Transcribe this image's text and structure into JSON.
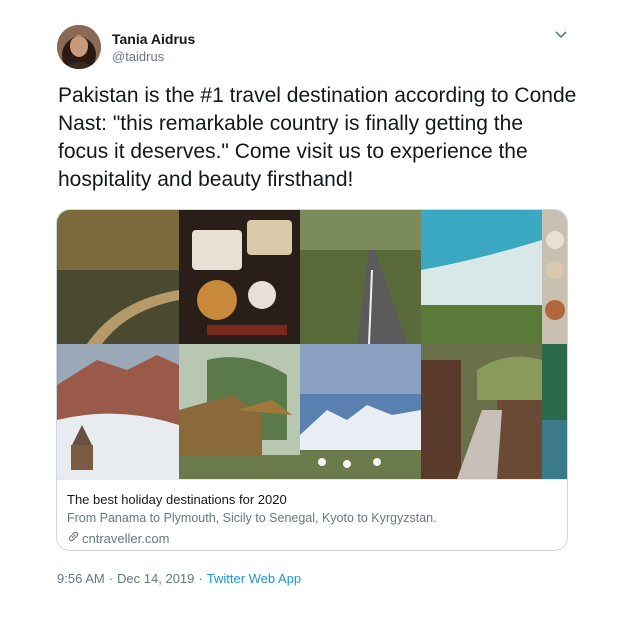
{
  "user": {
    "name": "Tania Aidrus",
    "handle": "@taidrus"
  },
  "tweet": {
    "text": "Pakistan is the #1 travel destination according to Conde Nast: \"this remarkable country is finally getting the focus it deserves.\" Come visit us to experience the hospitality and beauty firsthand!"
  },
  "card": {
    "title": "The best holiday destinations for 2020",
    "description": "From Panama to Plymouth, Sicily to Senegal, Kyoto to Kyrgyzstan.",
    "domain": "cntraveller.com"
  },
  "meta": {
    "time": "9:56 AM",
    "date": "Dec 14, 2019",
    "app": "Twitter Web App"
  },
  "colors": {
    "link": "#1b95e0",
    "secondary_text": "#657786",
    "border": "#ccd6dd"
  },
  "icons": {
    "more": "chevron-down-icon",
    "domain": "link-icon"
  }
}
